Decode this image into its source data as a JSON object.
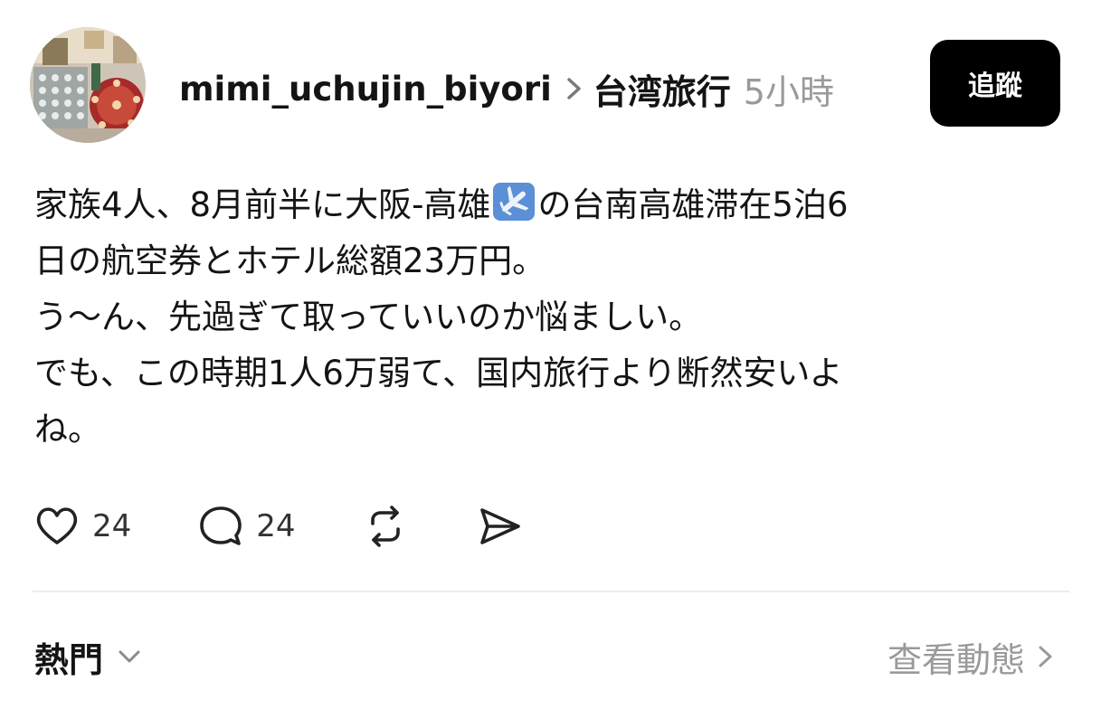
{
  "post": {
    "username": "mimi_uchujin_biyori",
    "topic": "台湾旅行",
    "time": "5小時",
    "follow_label": "追蹤",
    "body_lines": [
      [
        "家族4人、8月前半に大阪-高雄",
        "の台南高雄滞在5泊6"
      ],
      "日の航空券とホテル総額23万円。",
      "う〜ん、先過ぎて取っていいのか悩ましい。",
      "でも、この時期1人6万弱て、国内旅行より断然安いよ",
      "ね。"
    ],
    "like_count": "24",
    "reply_count": "24"
  },
  "footer": {
    "sort_label": "熱門",
    "activity_label": "查看動態"
  },
  "icons": {
    "avatar": "avatar-photo",
    "separator": "chevron-right-icon",
    "plane": "airplane-emoji-icon",
    "like": "heart-icon",
    "reply": "comment-bubble-icon",
    "repost": "repost-icon",
    "share": "send-icon",
    "sort": "chevron-down-icon",
    "activity": "chevron-right-icon"
  }
}
